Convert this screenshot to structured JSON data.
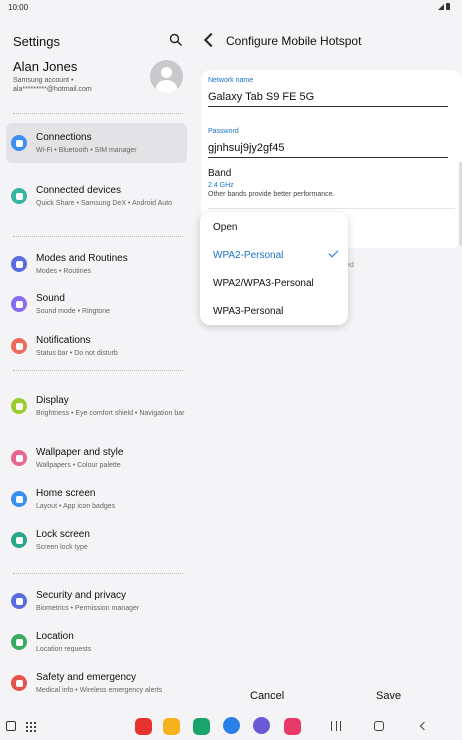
{
  "status_bar": {
    "time": "10:00"
  },
  "left_panel": {
    "title": "Settings",
    "profile": {
      "name": "Alan Jones",
      "account_line": "Samsung account  •",
      "email": "ala*********@hotmail.com"
    },
    "items": [
      {
        "label": "Connections",
        "sub": "Wi-Fi  •  Bluetooth  •  SIM manager",
        "icon": "wifi-icon",
        "color": "#3d8ff0",
        "active": true
      },
      {
        "label": "Connected devices",
        "sub": "Quick Share  •  Samsung DeX  •  Android Auto",
        "icon": "connected-devices-icon",
        "color": "#36b5a2",
        "active": false
      },
      {
        "label": "Modes and Routines",
        "sub": "Modes  •  Routines",
        "icon": "check-circle-icon",
        "color": "#5a6de0",
        "active": false
      },
      {
        "label": "Sound",
        "sub": "Sound mode  •  Ringtone",
        "icon": "speaker-icon",
        "color": "#8a6cf0",
        "active": false
      },
      {
        "label": "Notifications",
        "sub": "Status bar  •  Do not disturb",
        "icon": "bell-icon",
        "color": "#ee6a5a",
        "active": false
      },
      {
        "label": "Display",
        "sub": "Brightness  •  Eye comfort shield  •  Navigation bar",
        "icon": "sun-icon",
        "color": "#9bcb2c",
        "active": false
      },
      {
        "label": "Wallpaper and style",
        "sub": "Wallpapers  •  Colour palette",
        "icon": "wallpaper-icon",
        "color": "#e9668e",
        "active": false
      },
      {
        "label": "Home screen",
        "sub": "Layout  •  App icon badges",
        "icon": "home-icon",
        "color": "#3a8ff0",
        "active": false
      },
      {
        "label": "Lock screen",
        "sub": "Screen lock type",
        "icon": "lock-icon",
        "color": "#27a88a",
        "active": false
      },
      {
        "label": "Security and privacy",
        "sub": "Biometrics  •  Permission manager",
        "icon": "shield-icon",
        "color": "#5a6de0",
        "active": false
      },
      {
        "label": "Location",
        "sub": "Location requests",
        "icon": "location-pin-icon",
        "color": "#3aaa63",
        "active": false
      },
      {
        "label": "Safety and emergency",
        "sub": "Medical info  •  Wireless emergency alerts",
        "icon": "emergency-icon",
        "color": "#e5524b",
        "active": false
      }
    ]
  },
  "right_panel": {
    "title": "Configure Mobile Hotspot",
    "network_name_label": "Network name",
    "network_name_value": "Galaxy Tab S9 FE 5G",
    "password_label": "Password",
    "password_value": "gjnhsuj9jy2gf45",
    "band_label": "Band",
    "band_value": "2.4 GHz",
    "band_description": "Other bands provide better performance.",
    "partial_hidden_text": "ed",
    "cancel_label": "Cancel",
    "save_label": "Save"
  },
  "security_dropdown": {
    "options": [
      "Open",
      "WPA2-Personal",
      "WPA2/WPA3-Personal",
      "WPA3-Personal"
    ],
    "selected": "WPA2-Personal"
  },
  "nav_bar": {
    "apps": [
      {
        "name": "flipboard-app-icon",
        "color": "#e8322e"
      },
      {
        "name": "my-files-app-icon",
        "color": "#f5b21c"
      },
      {
        "name": "phone-app-icon",
        "color": "#19a46b"
      },
      {
        "name": "messages-app-icon",
        "color": "#2b7fe8"
      },
      {
        "name": "internet-app-icon",
        "color": "#6b5ad6"
      },
      {
        "name": "camera-app-icon",
        "color": "#e83a6a"
      }
    ]
  }
}
